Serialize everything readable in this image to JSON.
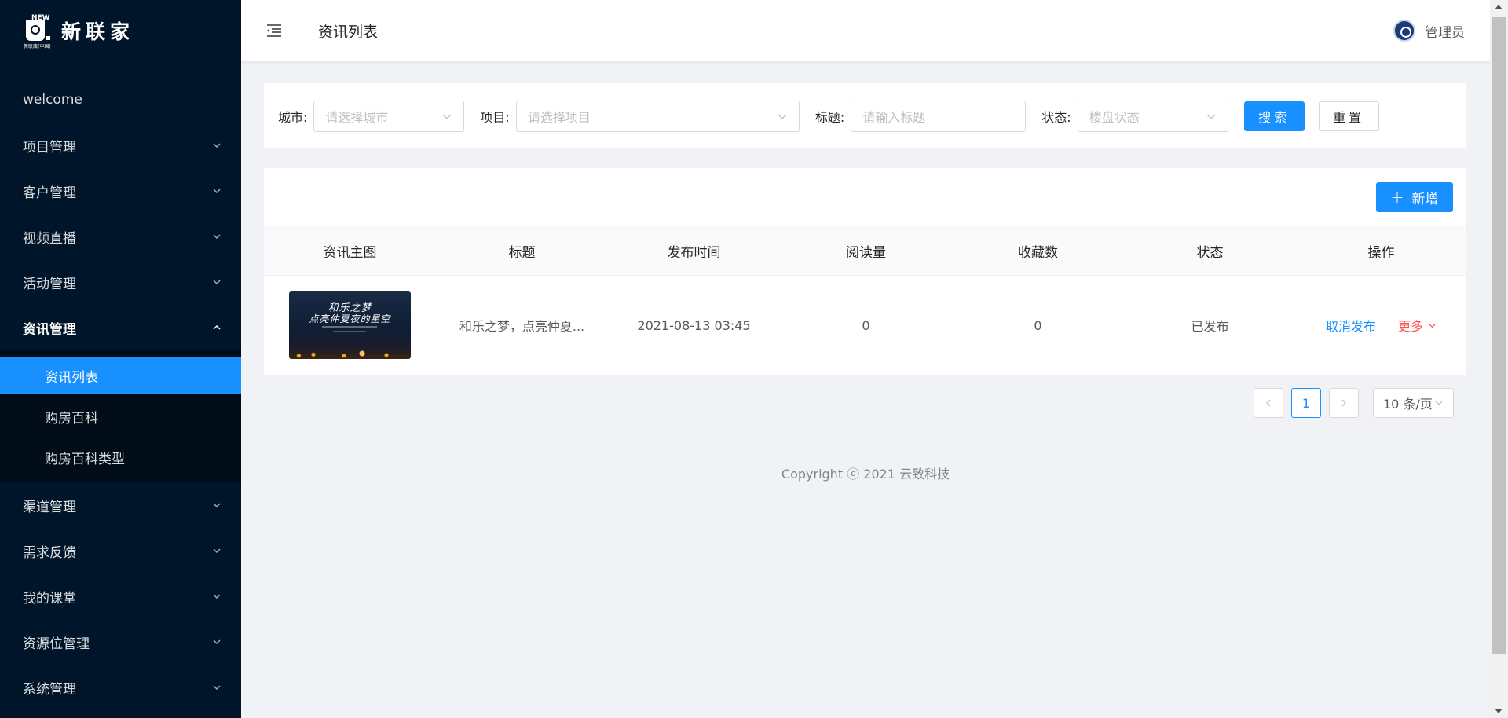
{
  "brand": {
    "name": "新联家",
    "logo_top": "NEW",
    "logo_sub": "新联康(中国)"
  },
  "sidebar": {
    "items": [
      {
        "label": "welcome"
      },
      {
        "label": "项目管理"
      },
      {
        "label": "客户管理"
      },
      {
        "label": "视频直播"
      },
      {
        "label": "活动管理"
      },
      {
        "label": "资讯管理",
        "open": true,
        "children": [
          {
            "label": "资讯列表",
            "active": true
          },
          {
            "label": "购房百科"
          },
          {
            "label": "购房百科类型"
          }
        ]
      },
      {
        "label": "渠道管理"
      },
      {
        "label": "需求反馈"
      },
      {
        "label": "我的课堂"
      },
      {
        "label": "资源位管理"
      },
      {
        "label": "系统管理"
      }
    ]
  },
  "header": {
    "title": "资讯列表",
    "user": "管理员"
  },
  "filters": {
    "city": {
      "label": "城市:",
      "placeholder": "请选择城市"
    },
    "project": {
      "label": "项目:",
      "placeholder": "请选择项目"
    },
    "title": {
      "label": "标题:",
      "placeholder": "请输入标题"
    },
    "status": {
      "label": "状态:",
      "placeholder": "楼盘状态"
    },
    "search_label": "搜索",
    "reset_label": "重置"
  },
  "table": {
    "add_label": "新增",
    "columns": [
      "资讯主图",
      "标题",
      "发布时间",
      "阅读量",
      "收藏数",
      "状态",
      "操作"
    ],
    "rows": [
      {
        "image_text_line1": "和乐之梦",
        "image_text_line2": "点亮仲夏夜的星空",
        "title": "和乐之梦，点亮仲夏...",
        "publish_time": "2021-08-13 03:45",
        "reads": "0",
        "favorites": "0",
        "status": "已发布",
        "action_primary": "取消发布",
        "action_more": "更多"
      }
    ]
  },
  "pagination": {
    "current": "1",
    "page_size": "10 条/页"
  },
  "footer": {
    "copyright": "Copyright ⓒ 2021 云致科技"
  },
  "colors": {
    "sidebar_bg": "#001529",
    "primary": "#1890ff",
    "danger": "#ff4d4f"
  }
}
